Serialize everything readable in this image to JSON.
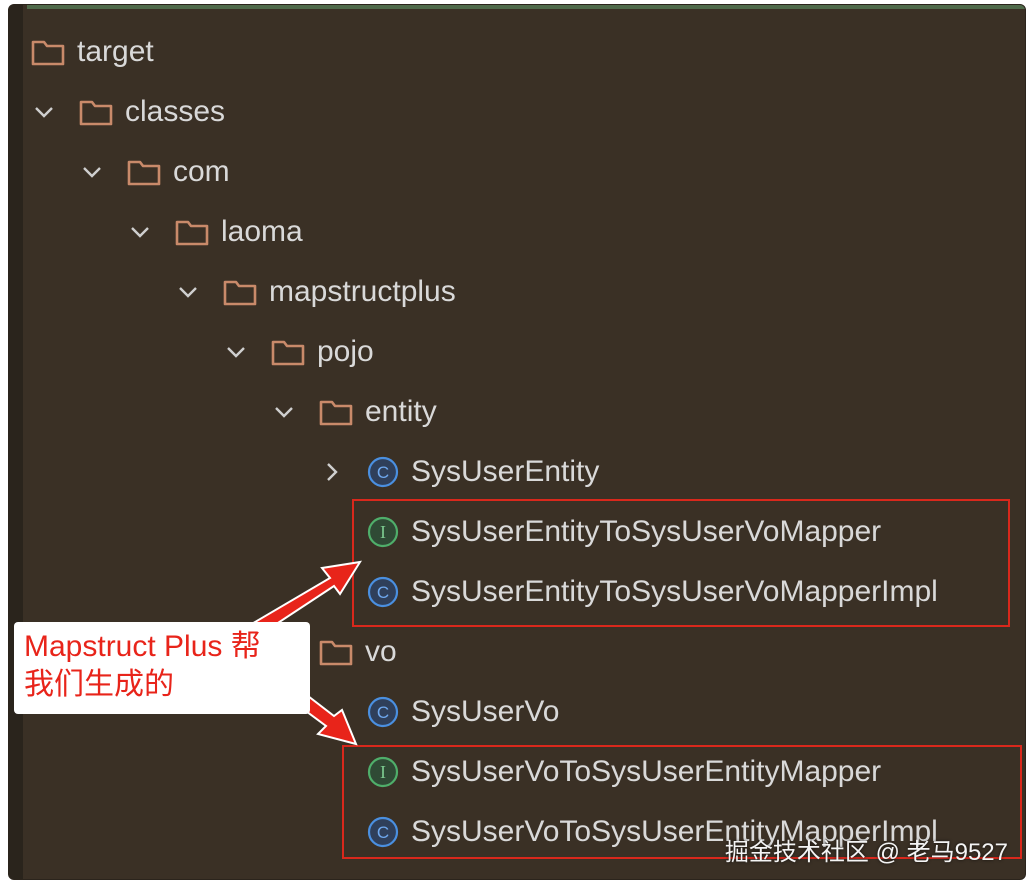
{
  "tree": {
    "items": [
      {
        "label": "target"
      },
      {
        "label": "classes"
      },
      {
        "label": "com"
      },
      {
        "label": "laoma"
      },
      {
        "label": "mapstructplus"
      },
      {
        "label": "pojo"
      },
      {
        "label": "entity"
      },
      {
        "label": "SysUserEntity"
      },
      {
        "label": "SysUserEntityToSysUserVoMapper"
      },
      {
        "label": "SysUserEntityToSysUserVoMapperImpl"
      },
      {
        "label": "vo"
      },
      {
        "label": "SysUserVo"
      },
      {
        "label": "SysUserVoToSysUserEntityMapper"
      },
      {
        "label": "SysUserVoToSysUserEntityMapperImpl"
      }
    ]
  },
  "annotation": {
    "line1": "Mapstruct Plus 帮",
    "line2": "我们生成的"
  },
  "watermark": "掘金技术社区 @ 老马9527",
  "colors": {
    "background": "#3a3025",
    "folder": "#c98a6a",
    "class_icon": "#4a8fe0",
    "interface_icon": "#4fae6a",
    "highlight": "#d9281c"
  }
}
